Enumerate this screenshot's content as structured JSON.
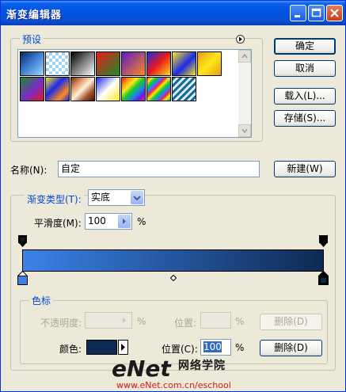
{
  "window": {
    "title": "渐变编辑器"
  },
  "presets": {
    "label": "预设",
    "swatches": [
      "linear-gradient(135deg,#0a2a5a,#3a7ad0 45%,#9ed8ff)",
      "repeating-conic-gradient(#9fd6f3 0 25%,#fff 0 50%) 0 0/8px 8px",
      "linear-gradient(135deg,#000,#fff)",
      "linear-gradient(135deg,#e81a1a,#1a8c2a)",
      "linear-gradient(135deg,#5a1ac8,#ff8a1a)",
      "linear-gradient(135deg,#1a2ae8,#e81a1a 50%,#ffd81a)",
      "linear-gradient(135deg,#ffe81a,#1a2ae8 55%,#ffe81a)",
      "linear-gradient(135deg,#e89a1a,#ffe81a 50%,#e89a1a)",
      "linear-gradient(135deg,#1a8c2a,#7a2ac8 55%,#e81a1a)",
      "linear-gradient(135deg,#ffe81a,#1a2ae8 40%,#ff8a1a 75%,#1a2ae8)",
      "linear-gradient(135deg,#6a2a10,#e8a070 30%,#fff0d8 50%,#a0502a 75%,#4a1808)",
      "linear-gradient(135deg,#1a2ae8,#fff 50%,#ffe81a)",
      "linear-gradient(135deg,#e81a1a,#ff8a1a,#ffe81a,#1ac82a,#1a8ae8,#6a1ae8,#e81ab8)",
      "repeating-linear-gradient(135deg,#e81a1a 0,#ffe81a 4px,#1ac82a 8px,#1a8ae8 12px,#e81ab8 16px)",
      "repeating-linear-gradient(135deg,#1a6a9a 0 3px,#dff2ff 3px 6px)"
    ]
  },
  "buttons": {
    "ok": "确定",
    "cancel": "取消",
    "load": "载入(L)...",
    "save": "存储(S)...",
    "new": "新建(W)"
  },
  "name": {
    "label": "名称(N):",
    "value": "自定"
  },
  "gradient": {
    "type_label": "渐变类型(T):",
    "type_value": "实底",
    "smooth_label": "平滑度(M):",
    "smooth_value": "100",
    "smooth_unit": "%",
    "start_color": "#3b82e8",
    "end_color": "#0e2a52"
  },
  "color_stops": {
    "label": "色标",
    "opacity_label": "不透明度:",
    "opacity_unit": "%",
    "opacity_location_label": "位置:",
    "opacity_location_unit": "%",
    "delete_opacity": "删除(D)",
    "color_label": "颜色:",
    "color_value": "#0e2a52",
    "location_label": "位置(C):",
    "location_value": "100",
    "location_unit": "%",
    "delete_color": "删除(D)"
  },
  "watermark": {
    "logo": "eNet",
    "tagline": "网络学院",
    "url": "www.eNet.com.cn/eschool"
  }
}
